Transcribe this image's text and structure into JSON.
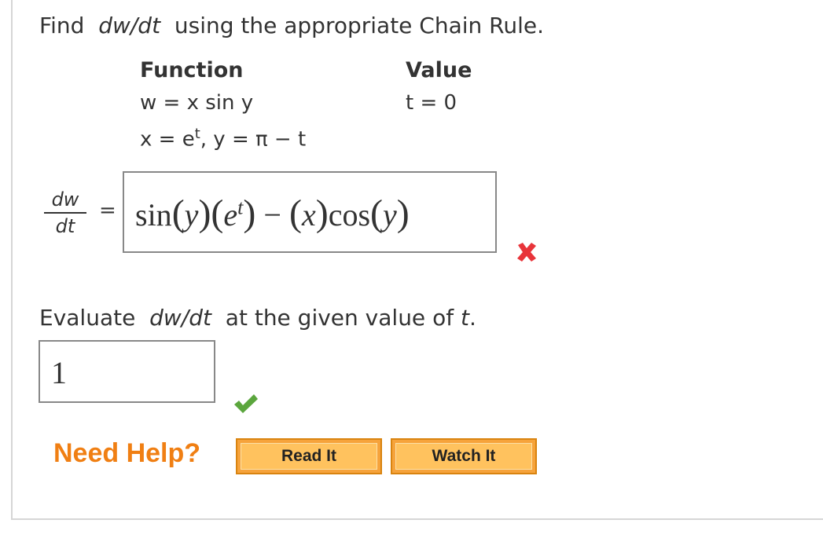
{
  "question": {
    "find_prefix": "Find",
    "find_var": "dw/dt",
    "find_suffix": "using the appropriate Chain Rule."
  },
  "table": {
    "function_header": "Function",
    "value_header": "Value",
    "function_line1": "w = x sin y",
    "function_line2_x": "x = e",
    "function_line2_exp": "t",
    "function_line2_rest": ", y = π − t",
    "value_line1": "t = 0"
  },
  "derivative": {
    "numerator": "dw",
    "denominator": "dt",
    "equals": "=",
    "answer": {
      "sin": "sin",
      "y1": "y",
      "e": "e",
      "t": "t",
      "minus": "−",
      "x": "x",
      "cos": "cos",
      "y2": "y"
    },
    "status": "incorrect",
    "status_icon": "cross-icon",
    "status_color": "#e8343a"
  },
  "evaluate": {
    "prefix": "Evaluate",
    "var": "dw/dt",
    "middle": "at the given value of",
    "t": "t",
    "period": ".",
    "answer": "1",
    "status": "correct",
    "status_icon": "check-icon",
    "status_color": "#5ba63d"
  },
  "help": {
    "label": "Need Help?",
    "read_label": "Read It",
    "watch_label": "Watch It",
    "accent": "#f07f13"
  }
}
